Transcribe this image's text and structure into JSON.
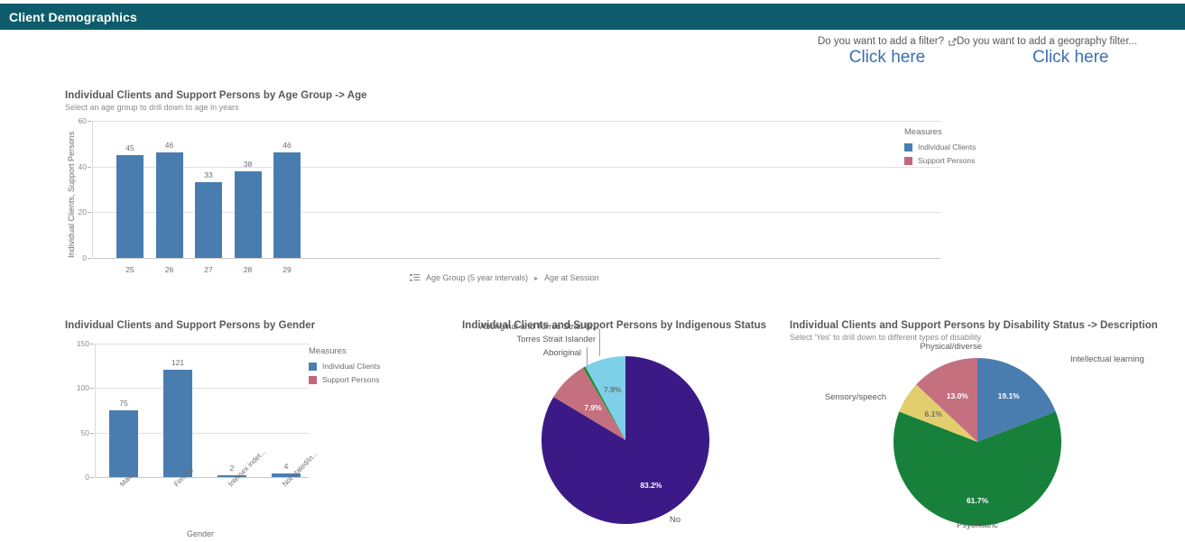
{
  "header": {
    "title": "Client Demographics"
  },
  "filters": [
    {
      "question": "Do you want to add a filter?",
      "icon": "external-link-icon",
      "link": "Click here"
    },
    {
      "question": "Do you want to add a geography filter...",
      "icon": "none",
      "link": "Click here"
    }
  ],
  "colors": {
    "header_bg": "#0e5c6b",
    "link": "#3a6fb0",
    "bar_blue": "#4a7daf",
    "individual_clients": "#4a7daf",
    "support_persons": "#c4667a",
    "pie_purple": "#3b1a87",
    "pie_lightblue": "#7ecfe8",
    "pie_green": "#1a8a2e",
    "pie_pink": "#c4707f",
    "pie_blue": "#4a7daf",
    "pie_darkgreen": "#17803a",
    "pie_yellow": "#e2ce6e"
  },
  "charts": {
    "age": {
      "title": "Individual Clients and Support Persons by Age Group -> Age",
      "subtitle": "Select an age group to drill down to age in years",
      "legend_title": "Measures",
      "legend": [
        "Individual Clients",
        "Support Persons"
      ],
      "breadcrumb": [
        "Age Group (5 year intervals)",
        "Age at Session"
      ],
      "breadcrumb_separator": "▸"
    },
    "gender": {
      "title": "Individual Clients and Support Persons by Gender",
      "legend_title": "Measures",
      "legend": [
        "Individual Clients",
        "Support Persons"
      ]
    },
    "indigenous": {
      "title": "Individual Clients and Support Persons by Indigenous Status"
    },
    "disability": {
      "title": "Individual Clients and Support Persons by Disability Status -> Description",
      "subtitle": "Select 'Yes' to drill down to different types of disability"
    }
  },
  "chart_data": [
    {
      "id": "age",
      "type": "bar",
      "title": "Individual Clients and Support Persons by Age Group -> Age",
      "subtitle": "Select an age group to drill down to age in years",
      "xlabel": "",
      "ylabel": "Individual Clients, Support Persons",
      "categories": [
        "25",
        "26",
        "27",
        "28",
        "29"
      ],
      "yticks": [
        "0",
        "20",
        "40",
        "60"
      ],
      "ylim": [
        0,
        60
      ],
      "grid": true,
      "legend_position": "right",
      "series": [
        {
          "name": "Individual Clients",
          "color": "#4a7daf",
          "values": [
            45,
            46,
            33,
            38,
            46
          ]
        },
        {
          "name": "Support Persons",
          "color": "#c4667a",
          "values": [
            0,
            0,
            0,
            0,
            0
          ]
        }
      ]
    },
    {
      "id": "gender",
      "type": "bar",
      "title": "Individual Clients and Support Persons by Gender",
      "xlabel": "Gender",
      "ylabel": "",
      "categories": [
        "Male",
        "Female",
        "Intersex indet...",
        "Not stated/in..."
      ],
      "yticks": [
        "0",
        "50",
        "100",
        "150"
      ],
      "ylim": [
        0,
        150
      ],
      "grid": true,
      "legend_position": "right",
      "series": [
        {
          "name": "Individual Clients",
          "color": "#4a7daf",
          "values": [
            75,
            121,
            2,
            4
          ]
        },
        {
          "name": "Support Persons",
          "color": "#c4667a",
          "values": [
            0,
            0,
            0,
            0
          ]
        }
      ]
    },
    {
      "id": "indigenous",
      "type": "pie",
      "title": "Individual Clients and Support Persons by Indigenous Status",
      "labels": [
        "No",
        "Aboriginal and Torres Strait Is...",
        "Torres Strait Islander",
        "Aboriginal"
      ],
      "values": [
        83.2,
        7.9,
        0.5,
        7.9
      ],
      "value_labels": [
        "83.2%",
        "7.9%",
        "",
        "7.9%"
      ],
      "colors": [
        "#3b1a87",
        "#c4707f",
        "#1a8a2e",
        "#7ecfe8"
      ]
    },
    {
      "id": "disability",
      "type": "pie",
      "title": "Individual Clients and Support Persons by Disability Status -> Description",
      "subtitle": "Select 'Yes' to drill down to different types of disability",
      "labels": [
        "Intellectual learning",
        "Psychiatric",
        "Sensory/speech",
        "Physical/diverse"
      ],
      "values": [
        19.1,
        61.7,
        6.1,
        13.0
      ],
      "value_labels": [
        "19.1%",
        "61.7%",
        "6.1%",
        "13.0%"
      ],
      "colors": [
        "#4a7daf",
        "#17803a",
        "#e2ce6e",
        "#c4707f"
      ]
    }
  ]
}
